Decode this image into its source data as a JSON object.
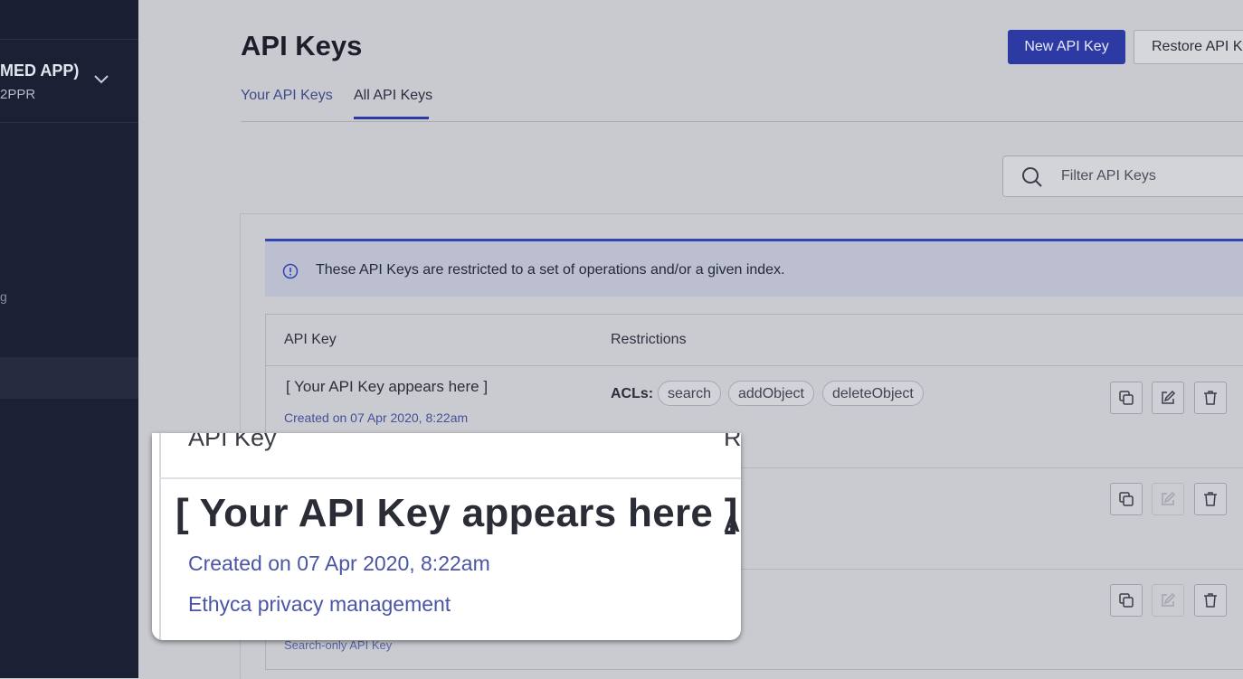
{
  "sidebar": {
    "app_name": "MED APP)",
    "app_id": "2PPR",
    "stub_text": "g"
  },
  "header": {
    "title": "API Keys",
    "new_button": "New API Key",
    "restore_button": "Restore API Key"
  },
  "tabs": [
    {
      "label": "Your API Keys",
      "active": false
    },
    {
      "label": "All API Keys",
      "active": true
    }
  ],
  "filter": {
    "placeholder": "Filter API Keys"
  },
  "banner": {
    "text": "These API Keys are restricted to a set of operations and/or a given index."
  },
  "table": {
    "headers": {
      "key": "API Key",
      "restrictions": "Restrictions"
    },
    "rows": [
      {
        "key": "[ Your API Key appears here ]",
        "created": "Created on 07 Apr 2020, 8:22am",
        "acl_label": "ACLs:",
        "acls": [
          "search",
          "addObject",
          "deleteObject"
        ]
      },
      {
        "key": "",
        "created": "",
        "acls": []
      },
      {
        "key": "",
        "created": "",
        "description": "Search-only API Key",
        "acls": []
      }
    ]
  },
  "zoom": {
    "header_key": "API Key",
    "header_restr": "R",
    "key": "[ Your API Key appears here ]",
    "acl_stub": "A",
    "created": "Created on 07 Apr 2020, 8:22am",
    "description": "Ethyca privacy management"
  },
  "colors": {
    "sidebar_bg": "#1b2034",
    "primary_button": "#2e3aa3",
    "banner_bg": "#bcbfcf",
    "link_text": "#44509a"
  }
}
